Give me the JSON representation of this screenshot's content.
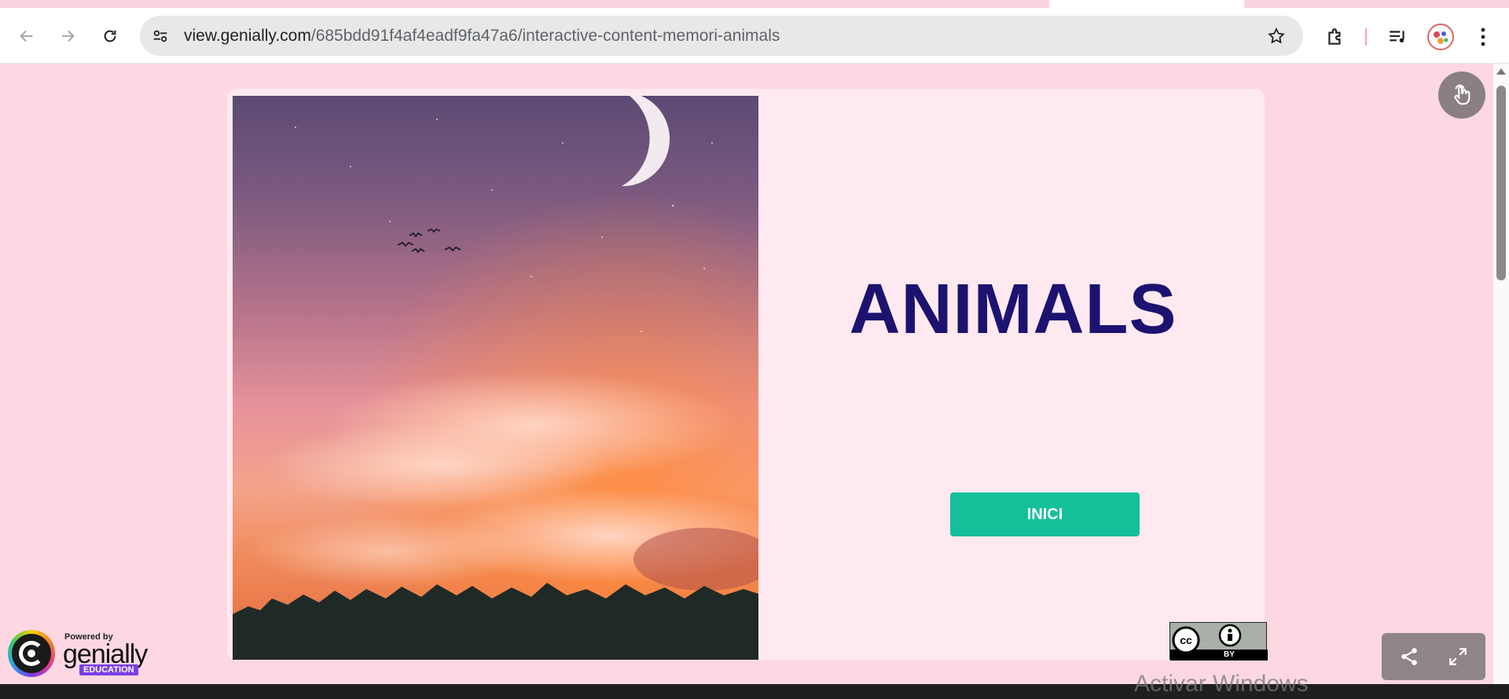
{
  "browser": {
    "url_host": "view.genially.com",
    "url_path": "/685bdd91f4af4eadf9fa47a6/interactive-content-memori-animals"
  },
  "slide": {
    "title": "ANIMALS",
    "start_button": "INICI"
  },
  "license_badge": {
    "label": "BY"
  },
  "powered_by": {
    "small_text": "Powered by",
    "brand": "genially",
    "edition": "EDUCATION"
  },
  "os": {
    "watermark": "Activar Windows"
  },
  "colors": {
    "background": "#fdd8e3",
    "card": "#ffe9f0",
    "title": "#1c1270",
    "button": "#14c09a",
    "edu_badge": "#7b3fe4"
  },
  "icons": {
    "back": "back-arrow-icon",
    "forward": "forward-arrow-icon",
    "reload": "reload-icon",
    "site_settings": "site-settings-icon",
    "bookmark": "star-icon",
    "extensions": "puzzle-icon",
    "media": "media-control-icon",
    "menu": "kebab-menu-icon",
    "pointer": "hand-pointer-icon",
    "share": "share-icon",
    "fullscreen": "fullscreen-icon"
  }
}
